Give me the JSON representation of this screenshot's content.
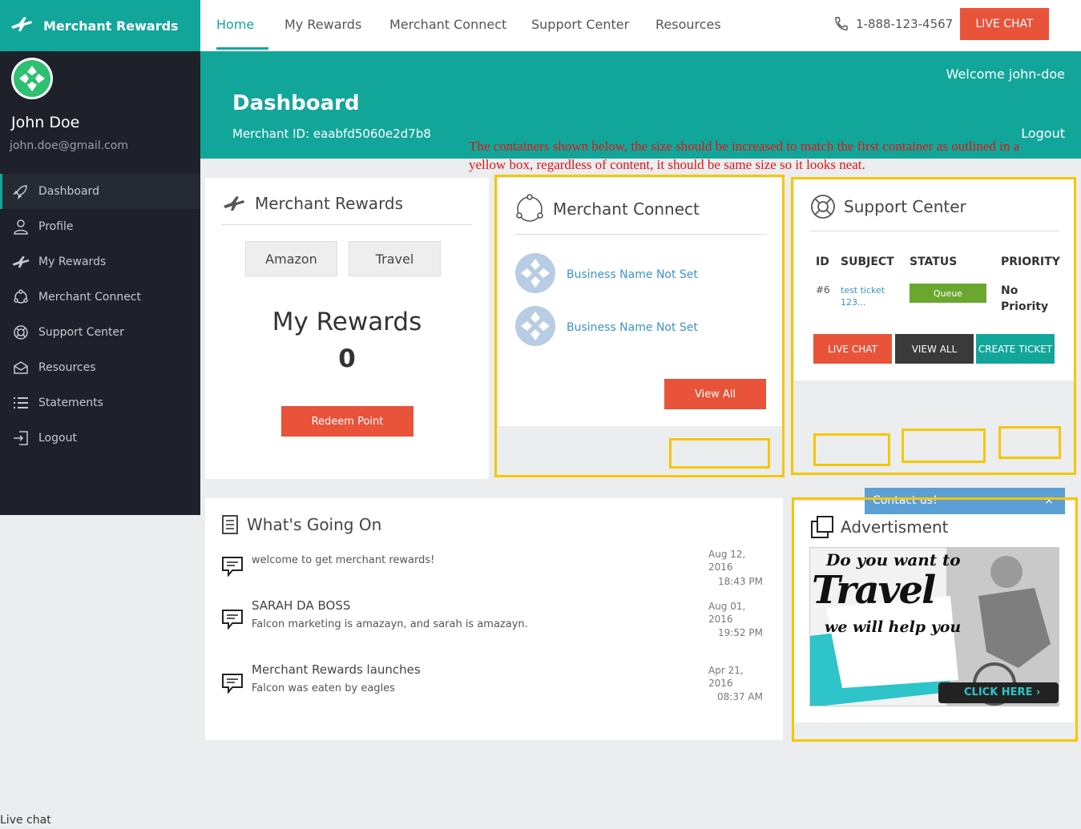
{
  "brand": {
    "name": "Merchant Rewards"
  },
  "user": {
    "name": "John Doe",
    "email": "john.doe@gmail.com"
  },
  "sidebar": {
    "items": [
      {
        "label": "Dashboard",
        "icon": "rocket-icon",
        "active": true
      },
      {
        "label": "Profile",
        "icon": "user-icon"
      },
      {
        "label": "My Rewards",
        "icon": "plane-icon"
      },
      {
        "label": "Merchant Connect",
        "icon": "connect-icon"
      },
      {
        "label": "Support Center",
        "icon": "lifebuoy-icon"
      },
      {
        "label": "Resources",
        "icon": "envelope-icon"
      },
      {
        "label": "Statements",
        "icon": "list-icon"
      },
      {
        "label": "Logout",
        "icon": "logout-icon"
      }
    ]
  },
  "topnav": {
    "tabs": [
      "Home",
      "My Rewards",
      "Merchant Connect",
      "Support Center",
      "Resources"
    ],
    "phone": "1-888-123-4567",
    "live_chat": "LIVE CHAT"
  },
  "header": {
    "welcome": "Welcome john-doe",
    "title": "Dashboard",
    "merchant_id": "Merchant ID: eaabfd5060e2d7b8",
    "logout": "Logout"
  },
  "annotation": "The containers shown below, the size should be increased to match the first container as outlined in a yellow box, regardless of content, it should be same size so it looks neat.",
  "rewards_card": {
    "title": "Merchant Rewards",
    "buttons": [
      "Amazon",
      "Travel"
    ],
    "heading": "My Rewards",
    "points": "0",
    "redeem": "Redeem Point"
  },
  "connect_card": {
    "title": "Merchant Connect",
    "items": [
      "Business Name Not Set",
      "Business Name Not Set"
    ],
    "view_all": "View All"
  },
  "support_card": {
    "title": "Support Center",
    "headers": [
      "ID",
      "SUBJECT",
      "STATUS",
      "PRIORITY"
    ],
    "row": {
      "id": "#6",
      "subject_1": "test ticket",
      "subject_2": "123...",
      "status": "Queue",
      "priority_1": "No",
      "priority_2": "Priority"
    },
    "buttons": [
      "LIVE CHAT",
      "VIEW ALL",
      "CREATE TICKET"
    ]
  },
  "feed_card": {
    "title": "What's Going On",
    "items": [
      {
        "title": "welcome to get merchant rewards!",
        "sub": "",
        "date_1": "Aug 12,",
        "date_2": "2016",
        "time": "18:43 PM"
      },
      {
        "title": "SARAH DA BOSS",
        "sub": "Falcon marketing is amazayn, and sarah is amazayn.",
        "date_1": "Aug 01,",
        "date_2": "2016",
        "time": "19:52 PM"
      },
      {
        "title": "Merchant Rewards launches",
        "sub": "Falcon was eaten by eagles",
        "date_1": "Apr 21,",
        "date_2": "2016",
        "time": "08:37 AM"
      }
    ]
  },
  "ad_card": {
    "title": "Advertisment",
    "line1": "Do you want to",
    "line2": "Travel",
    "line3": "we will help you",
    "cta": "CLICK HERE"
  },
  "contact_widget": {
    "label": "Contact us!",
    "close": "×"
  },
  "footer": {
    "live_chat": "Live chat"
  },
  "colors": {
    "teal": "#12a69a",
    "red": "#e8533a",
    "sidebar": "#1e2129",
    "highlight": "#f7c600",
    "queue": "#6aa72f"
  }
}
